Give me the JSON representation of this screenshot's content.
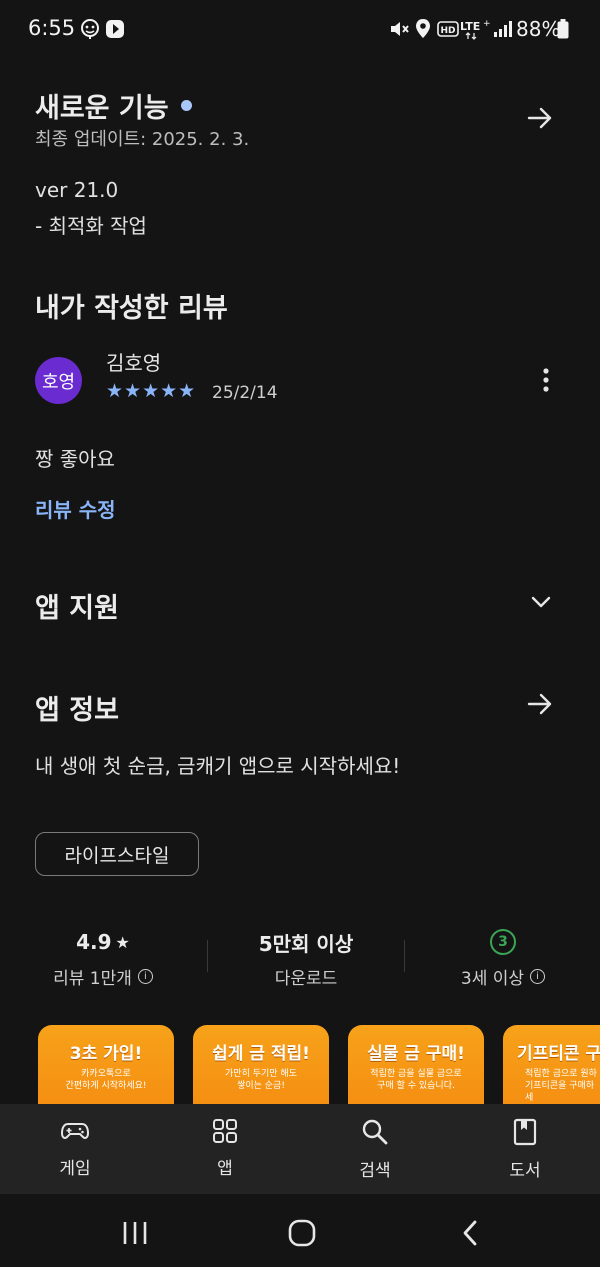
{
  "status_bar": {
    "time": "6:55",
    "battery": "88%"
  },
  "whats_new": {
    "title": "새로운 기능",
    "updated": "최종 업데이트: 2025. 2. 3.",
    "version": "ver 21.0",
    "note": "- 최적화 작업"
  },
  "my_review": {
    "heading": "내가 작성한 리뷰",
    "avatar_text": "호영",
    "author": "김호영",
    "rating": 5,
    "stars": "★★★★★",
    "date": "25/2/14",
    "text": "짱 좋아요",
    "edit_link": "리뷰 수정"
  },
  "app_support": {
    "title": "앱 지원"
  },
  "app_info": {
    "title": "앱 정보",
    "description": "내 생애 첫 순금, 금캐기 앱으로 시작하세요!",
    "category": "라이프스타일"
  },
  "stats": {
    "rating_value": "4.9",
    "rating_label": "리뷰 1만개",
    "downloads_value": "5만회 이상",
    "downloads_label": "다운로드",
    "age_value": "3",
    "age_label": "3세 이상"
  },
  "screenshots": [
    {
      "title": "3초 가입!",
      "desc": "카카오톡으로\n간편하게 시작하세요!"
    },
    {
      "title": "쉽게 금 적립!",
      "desc": "가만히 두기만 해도\n쌓이는 순금!"
    },
    {
      "title": "실물 금 구매!",
      "desc": "적립한 금을 실물 금으로\n구매 할 수 있습니다."
    },
    {
      "title": "기프티콘 구",
      "desc": "적립한 금으로 원하\n기프티콘을 구매하세"
    }
  ],
  "bottom_nav": [
    {
      "label": "게임",
      "icon": "gamepad-icon"
    },
    {
      "label": "앱",
      "icon": "apps-grid-icon"
    },
    {
      "label": "검색",
      "icon": "search-icon"
    },
    {
      "label": "도서",
      "icon": "book-icon"
    }
  ],
  "colors": {
    "accent": "#8ab4f8",
    "avatar": "#6a2bd0",
    "age_badge": "#3aa655",
    "screenshot_bg": "#f7a21a"
  }
}
